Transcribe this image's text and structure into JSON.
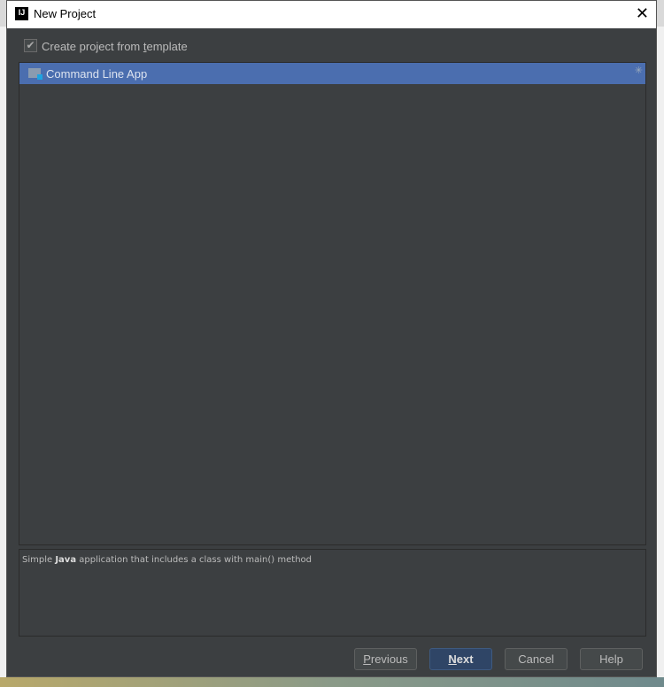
{
  "window": {
    "title": "New Project",
    "app_icon": "intellij-icon",
    "close_icon": "close-icon"
  },
  "template_checkbox": {
    "label_pre": "Create project from ",
    "label_u": "t",
    "label_post": "emplate",
    "checked": true
  },
  "templates": [
    {
      "label": "Command Line App",
      "icon": "folder-icon",
      "selected": true
    }
  ],
  "description": {
    "pre": "Simple ",
    "bold": "Java",
    "post": " application that includes a class with main() method"
  },
  "buttons": {
    "previous": {
      "u": "P",
      "rest": "revious"
    },
    "next": {
      "u": "N",
      "rest": "ext"
    },
    "cancel": "Cancel",
    "help": "Help"
  },
  "colors": {
    "background": "#3c3f41",
    "selection": "#4b6eaf",
    "primary_button": "#2f4566"
  }
}
